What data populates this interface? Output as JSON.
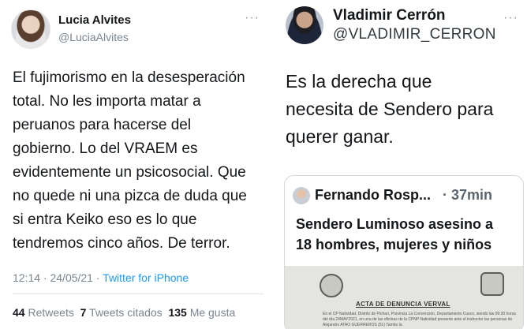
{
  "left_tweet": {
    "author_name": "Lucia Alvites",
    "author_handle": "@LuciaAlvites",
    "more_icon": "···",
    "text_lines": [
      "El fujimorismo en la desesperación",
      "total. No les importa matar a",
      "peruanos para hacerse del",
      "gobierno. Lo del VRAEM es",
      "evidentemente un psicosocial. Que",
      "no quede ni una pizca de duda que",
      "si entra Keiko eso es lo que",
      "tendremos cinco años. De terror."
    ],
    "timestamp": "12:14 · 24/05/21 · ",
    "source": "Twitter for iPhone",
    "retweets_count": "44",
    "retweets_label": "Retweets",
    "quotes_count": "7",
    "quotes_label": "Tweets citados",
    "likes_count": "135",
    "likes_label": "Me gusta"
  },
  "right_tweet": {
    "author_name": "Vladimir Cerrón",
    "author_handle": "@VLADIMIR_CERRON",
    "more_icon": "···",
    "text_lines": [
      "Es la derecha que",
      "necesita de Sendero para",
      "querer ganar."
    ],
    "quoted": {
      "author_name": "Fernando Rosp...",
      "time": "· 37min",
      "text_lines": [
        "Sendero Luminoso asesino a",
        "18 hombres, mujeres y niños"
      ],
      "document_title": "ACTA DE DENUNCIA VERVAL",
      "document_body": "En el CP Natividad, Distrito de Pichari, Provincia La Convención, Departamento Cusco, siendo las 09:30 horas del día 24MAY2021, en una de las oficinas de la CPNP Natividad presente ante el instructor las personas de Alejandro ATAO GUERREROS (51) Tambo la"
    }
  }
}
